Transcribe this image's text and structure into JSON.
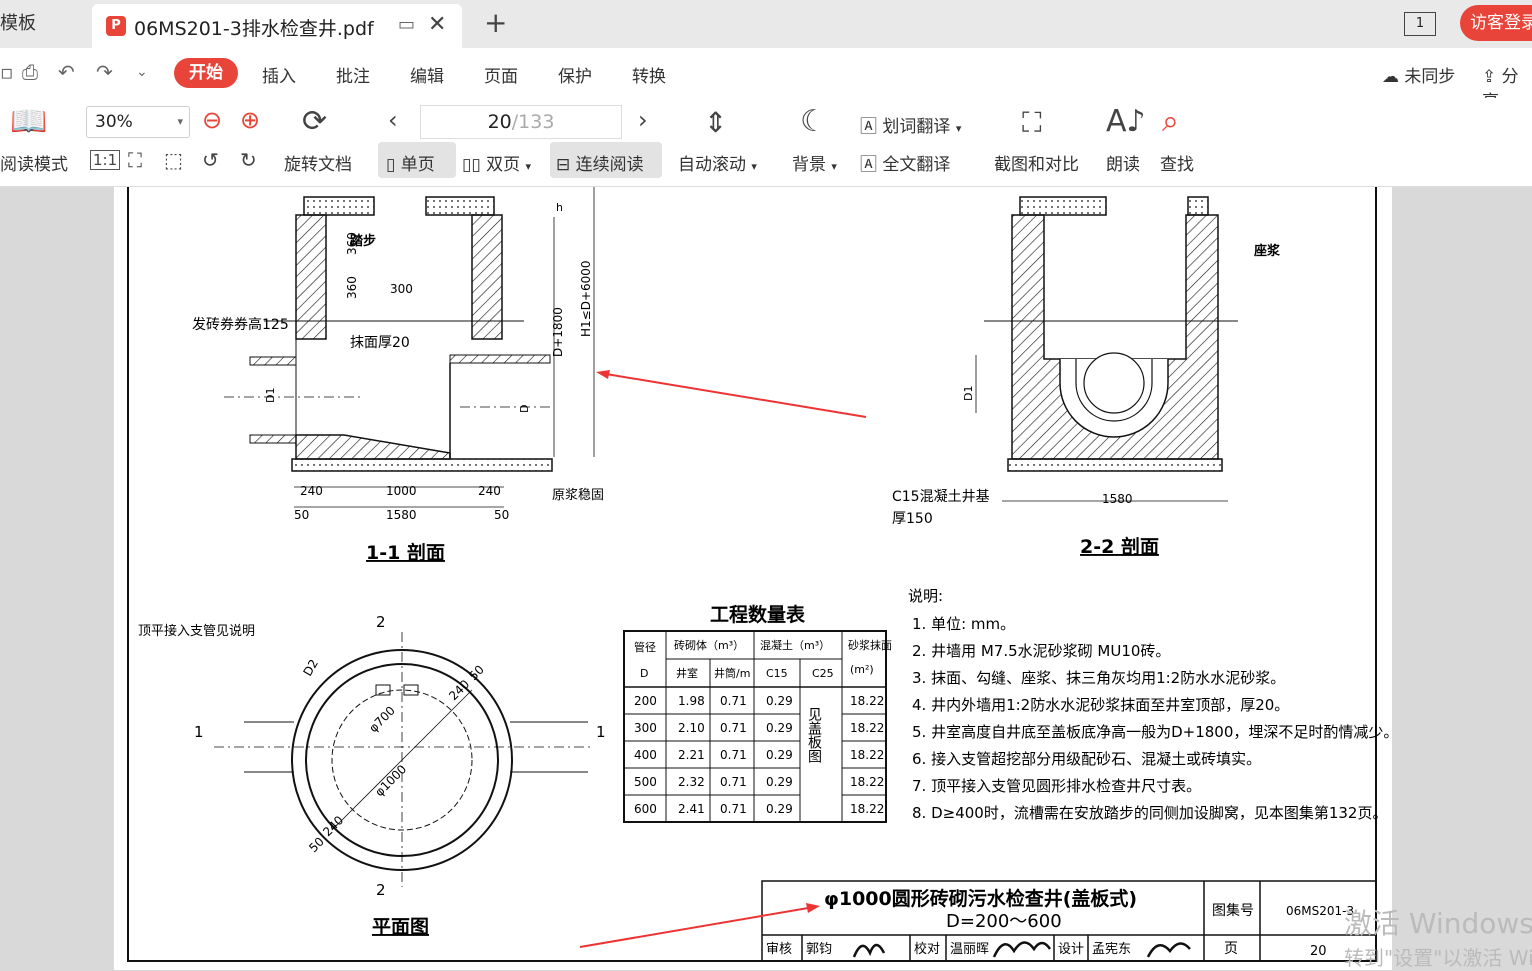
{
  "tabs": {
    "prev_label": "模板",
    "active_title": "06MS201-3排水检查井.pdf",
    "pdf_icon": "pdf-icon",
    "add_label": "+",
    "page_count_badge": "1",
    "login_label": "访客登录"
  },
  "menu": {
    "items": [
      "开始",
      "插入",
      "批注",
      "编辑",
      "页面",
      "保护",
      "转换"
    ],
    "sync_label": "未同步",
    "share_label": "分享"
  },
  "toolbar": {
    "read_mode": "阅读模式",
    "zoom": "30%",
    "rotate": "旋转文档",
    "page_current": "20",
    "page_total": "/133",
    "single_page": "单页",
    "double_page": "双页",
    "continuous": "连续阅读",
    "auto_scroll": "自动滚动",
    "background": "背景",
    "word_translate": "划词翻译",
    "full_translate": "全文翻译",
    "screenshot_compare": "截图和对比",
    "read_aloud": "朗读",
    "find": "查找",
    "fit_label": "1:1"
  },
  "drawing": {
    "section11_title": "1-1 剖面",
    "section22_title": "2-2 剖面",
    "plan_title": "平面图",
    "labels": {
      "step": "踏步",
      "arch": "发砖券券高125",
      "plaster": "抹面厚20",
      "tamp": "原浆稳固",
      "mortar": "座浆",
      "base": "C15混凝土井基",
      "base_thk": "厚150",
      "top_pipe": "顶平接入支管见说明",
      "dims": [
        "360",
        "360",
        "300",
        "240",
        "1000",
        "240",
        "50",
        "1580",
        "50",
        "D+1800",
        "H1≤D+6000",
        "D1",
        "D",
        "h",
        "1580",
        "D1",
        "φ700",
        "φ1000",
        "240",
        "50",
        "240",
        "50",
        "D2",
        "2",
        "2",
        "1",
        "1"
      ]
    },
    "table": {
      "title": "工程数量表",
      "headers": [
        "管径",
        "砖砌体（m³）",
        "混凝土（m³）",
        "砂浆抹面"
      ],
      "subheaders": [
        "D",
        "井室",
        "井筒/m",
        "C15",
        "C25",
        "(m²)"
      ],
      "c25_note": "见盖板图",
      "rows": [
        [
          "200",
          "1.98",
          "0.71",
          "0.29",
          "18.22"
        ],
        [
          "300",
          "2.10",
          "0.71",
          "0.29",
          "18.22"
        ],
        [
          "400",
          "2.21",
          "0.71",
          "0.29",
          "18.22"
        ],
        [
          "500",
          "2.32",
          "0.71",
          "0.29",
          "18.22"
        ],
        [
          "600",
          "2.41",
          "0.71",
          "0.29",
          "18.22"
        ]
      ]
    },
    "notes_title": "说明:",
    "notes": [
      "1.  单位: mm。",
      "2.  井墙用 M7.5水泥砂浆砌 MU10砖。",
      "3.  抹面、勾缝、座浆、抹三角灰均用1:2防水水泥砂浆。",
      "4.  井内外墙用1:2防水水泥砂浆抹面至井室顶部，厚20。",
      "5.  井室高度自井底至盖板底净高一般为D+1800，埋深不足时酌情减少。",
      "6.  接入支管超挖部分用级配砂石、混凝土或砖填实。",
      "7.  顶平接入支管见圆形排水检查井尺寸表。",
      "8.  D≥400时，流槽需在安放踏步的同侧加设脚窝，见本图集第132页。"
    ],
    "title_block": {
      "title": "φ1000圆形砖砌污水检查井(盖板式)",
      "subtitle": "D=200～600",
      "atlas_label": "图集号",
      "atlas_no": "06MS201-3",
      "page_label": "页",
      "page_no": "20",
      "row": [
        "审核",
        "郭钧",
        "校对",
        "温丽晖",
        "设计",
        "孟宪东"
      ]
    }
  },
  "watermark": {
    "line1": "激活 Windows",
    "line2": "转到\"设置\"以激活 Windows"
  }
}
